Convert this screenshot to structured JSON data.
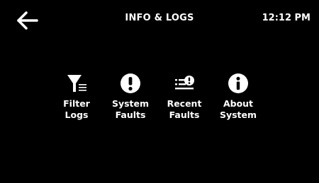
{
  "header": {
    "title": "INFO & LOGS",
    "time": "12:12 PM",
    "back_icon": "arrow-left-icon"
  },
  "menu": {
    "items": [
      {
        "line1": "Filter",
        "line2": "Logs",
        "icon": "filter-list-icon"
      },
      {
        "line1": "System",
        "line2": "Faults",
        "icon": "exclamation-circle-icon"
      },
      {
        "line1": "Recent",
        "line2": "Faults",
        "icon": "list-alert-icon"
      },
      {
        "line1": "About",
        "line2": "System",
        "icon": "info-circle-icon"
      }
    ]
  },
  "colors": {
    "background": "#000000",
    "foreground": "#ffffff"
  }
}
